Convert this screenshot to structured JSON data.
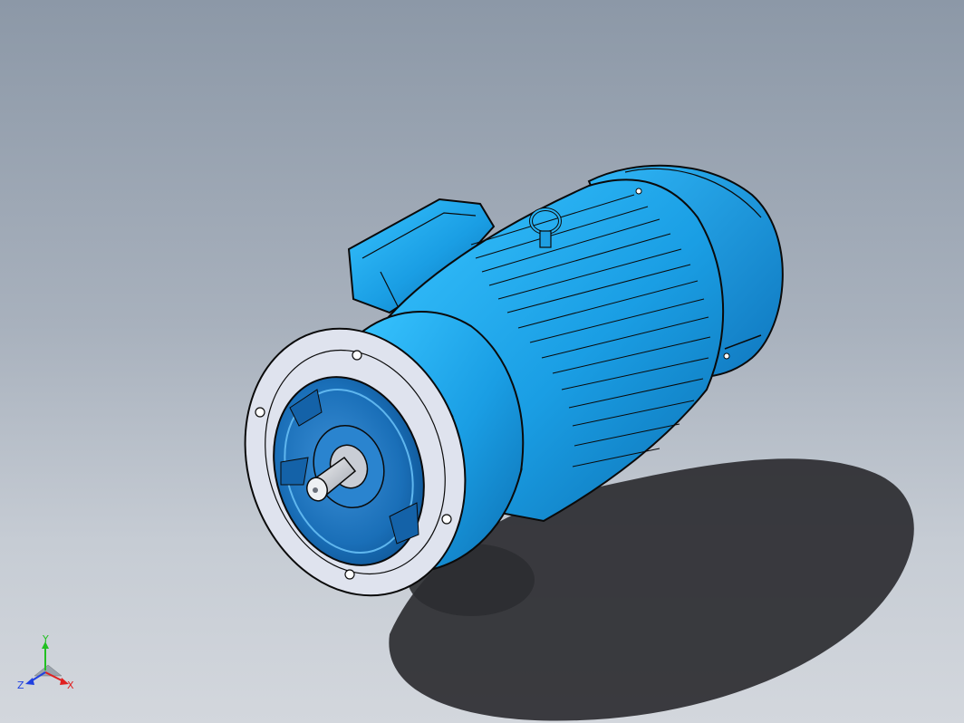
{
  "viewport": {
    "background_top": "#8c98a7",
    "background_bottom": "#d3d7dd"
  },
  "model": {
    "body_color": "#1aa3e8",
    "body_dark": "#0b6fb0",
    "body_light": "#39c6ff",
    "outline": "#0a0a0a",
    "flange_face": "#d8dce8",
    "shadow": "#2e2f33"
  },
  "triad": {
    "x_label": "X",
    "y_label": "Y",
    "z_label": "Z",
    "x_color": "#e02020",
    "y_color": "#22c022",
    "z_color": "#2040e0"
  }
}
